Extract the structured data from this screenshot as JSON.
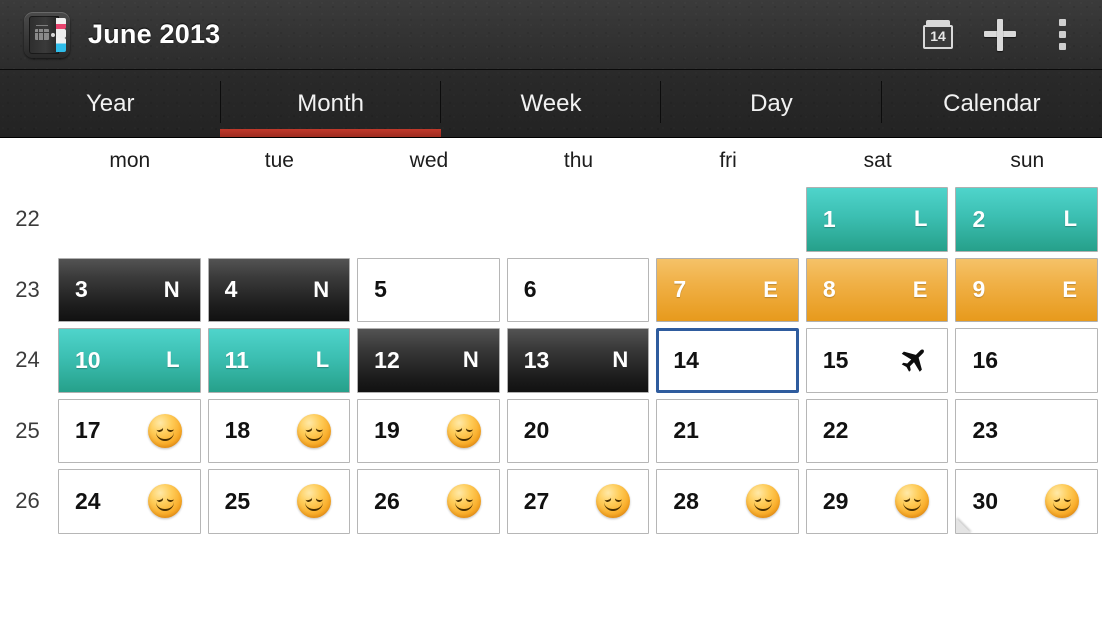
{
  "titlebar": {
    "app_icon_name": "planner-book-icon",
    "title": "June 2013",
    "actions": [
      {
        "name": "go-to-today-button",
        "icon": "calendar-14-icon",
        "label": "14"
      },
      {
        "name": "add-event-button",
        "icon": "plus-icon",
        "label": ""
      },
      {
        "name": "overflow-menu-button",
        "icon": "more-vertical-icon",
        "label": ""
      }
    ]
  },
  "tabs": {
    "active": "Month",
    "items": [
      {
        "label": "Year"
      },
      {
        "label": "Month"
      },
      {
        "label": "Week"
      },
      {
        "label": "Day"
      },
      {
        "label": "Calendar"
      }
    ]
  },
  "weekdays": [
    "mon",
    "tue",
    "wed",
    "thu",
    "fri",
    "sat",
    "sun"
  ],
  "colors": {
    "accent_tab_underline": "#c0392b",
    "shift_late_teal": "#3cbfb2",
    "shift_night_dark": "#1d1d1d",
    "shift_early_orange": "#f0b046",
    "selection_blue": "#2f5c9e",
    "titlebar": "#343434",
    "tabbar": "#262626"
  },
  "calendar": {
    "week_numbers": [
      "22",
      "23",
      "24",
      "25",
      "26"
    ],
    "rows": [
      {
        "week": "22",
        "cells": [
          {
            "day": "",
            "badge": "",
            "style": "empty",
            "icon": "",
            "selected": false,
            "curl": false
          },
          {
            "day": "",
            "badge": "",
            "style": "empty",
            "icon": "",
            "selected": false,
            "curl": false
          },
          {
            "day": "",
            "badge": "",
            "style": "empty",
            "icon": "",
            "selected": false,
            "curl": false
          },
          {
            "day": "",
            "badge": "",
            "style": "empty",
            "icon": "",
            "selected": false,
            "curl": false
          },
          {
            "day": "",
            "badge": "",
            "style": "empty",
            "icon": "",
            "selected": false,
            "curl": false
          },
          {
            "day": "1",
            "badge": "L",
            "style": "teal",
            "icon": "",
            "selected": false,
            "curl": false
          },
          {
            "day": "2",
            "badge": "L",
            "style": "teal",
            "icon": "",
            "selected": false,
            "curl": false
          }
        ]
      },
      {
        "week": "23",
        "cells": [
          {
            "day": "3",
            "badge": "N",
            "style": "dark",
            "icon": "",
            "selected": false,
            "curl": false
          },
          {
            "day": "4",
            "badge": "N",
            "style": "dark",
            "icon": "",
            "selected": false,
            "curl": false
          },
          {
            "day": "5",
            "badge": "",
            "style": "plain",
            "icon": "",
            "selected": false,
            "curl": false
          },
          {
            "day": "6",
            "badge": "",
            "style": "plain",
            "icon": "",
            "selected": false,
            "curl": false
          },
          {
            "day": "7",
            "badge": "E",
            "style": "orange",
            "icon": "",
            "selected": false,
            "curl": false
          },
          {
            "day": "8",
            "badge": "E",
            "style": "orange",
            "icon": "",
            "selected": false,
            "curl": false
          },
          {
            "day": "9",
            "badge": "E",
            "style": "orange",
            "icon": "",
            "selected": false,
            "curl": false
          }
        ]
      },
      {
        "week": "24",
        "cells": [
          {
            "day": "10",
            "badge": "L",
            "style": "teal",
            "icon": "",
            "selected": false,
            "curl": false
          },
          {
            "day": "11",
            "badge": "L",
            "style": "teal",
            "icon": "",
            "selected": false,
            "curl": false
          },
          {
            "day": "12",
            "badge": "N",
            "style": "dark",
            "icon": "",
            "selected": false,
            "curl": false
          },
          {
            "day": "13",
            "badge": "N",
            "style": "dark",
            "icon": "",
            "selected": false,
            "curl": false
          },
          {
            "day": "14",
            "badge": "",
            "style": "plain",
            "icon": "",
            "selected": true,
            "curl": false
          },
          {
            "day": "15",
            "badge": "",
            "style": "plain",
            "icon": "airplane-icon",
            "selected": false,
            "curl": false
          },
          {
            "day": "16",
            "badge": "",
            "style": "plain",
            "icon": "",
            "selected": false,
            "curl": false
          }
        ]
      },
      {
        "week": "25",
        "cells": [
          {
            "day": "17",
            "badge": "",
            "style": "plain",
            "icon": "smiley-icon",
            "selected": false,
            "curl": false
          },
          {
            "day": "18",
            "badge": "",
            "style": "plain",
            "icon": "smiley-icon",
            "selected": false,
            "curl": false
          },
          {
            "day": "19",
            "badge": "",
            "style": "plain",
            "icon": "smiley-icon",
            "selected": false,
            "curl": false
          },
          {
            "day": "20",
            "badge": "",
            "style": "plain",
            "icon": "",
            "selected": false,
            "curl": false
          },
          {
            "day": "21",
            "badge": "",
            "style": "plain",
            "icon": "",
            "selected": false,
            "curl": false
          },
          {
            "day": "22",
            "badge": "",
            "style": "plain",
            "icon": "",
            "selected": false,
            "curl": false
          },
          {
            "day": "23",
            "badge": "",
            "style": "plain",
            "icon": "",
            "selected": false,
            "curl": false
          }
        ]
      },
      {
        "week": "26",
        "cells": [
          {
            "day": "24",
            "badge": "",
            "style": "plain",
            "icon": "smiley-icon",
            "selected": false,
            "curl": false
          },
          {
            "day": "25",
            "badge": "",
            "style": "plain",
            "icon": "smiley-icon",
            "selected": false,
            "curl": false
          },
          {
            "day": "26",
            "badge": "",
            "style": "plain",
            "icon": "smiley-icon",
            "selected": false,
            "curl": false
          },
          {
            "day": "27",
            "badge": "",
            "style": "plain",
            "icon": "smiley-icon",
            "selected": false,
            "curl": false
          },
          {
            "day": "28",
            "badge": "",
            "style": "plain",
            "icon": "smiley-icon",
            "selected": false,
            "curl": false
          },
          {
            "day": "29",
            "badge": "",
            "style": "plain",
            "icon": "smiley-icon",
            "selected": false,
            "curl": false
          },
          {
            "day": "30",
            "badge": "",
            "style": "plain",
            "icon": "smiley-icon",
            "selected": false,
            "curl": true
          }
        ]
      }
    ]
  }
}
